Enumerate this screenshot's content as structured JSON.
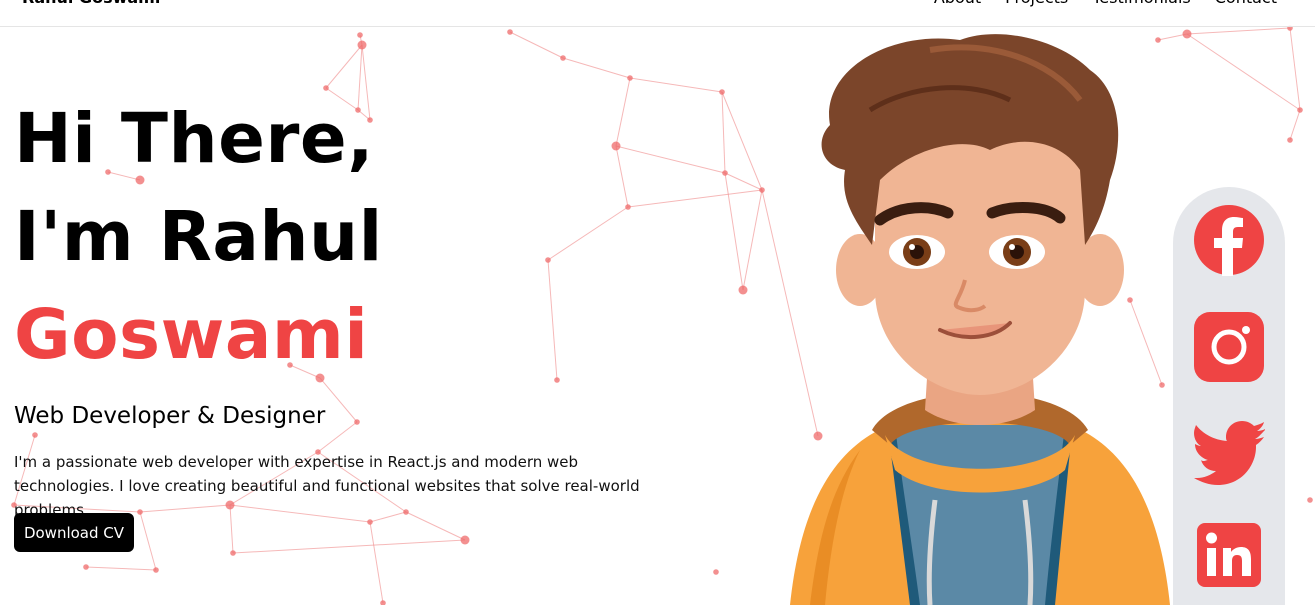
{
  "nav": {
    "brand": "Rahul Goswami",
    "items": [
      {
        "label": "About"
      },
      {
        "label": "Projects"
      },
      {
        "label": "Testimonials"
      },
      {
        "label": "Contact"
      }
    ]
  },
  "hero": {
    "line1": "Hi There,",
    "line2": "I'm Rahul",
    "line3": "Goswami",
    "subtitle": "Web Developer & Designer",
    "description": "I'm a passionate web developer with expertise in React.js and modern web technologies. I love creating beautiful and functional websites that solve real-world problems.",
    "cta": "Download CV"
  },
  "social": {
    "icons": [
      "facebook-icon",
      "instagram-icon",
      "twitter-icon",
      "linkedin-icon"
    ]
  },
  "colors": {
    "accent": "#ef4444",
    "button": "#000000",
    "social_bg": "#e5e7eb",
    "hoodie": "#f7a23b",
    "hair": "#7b452a"
  }
}
